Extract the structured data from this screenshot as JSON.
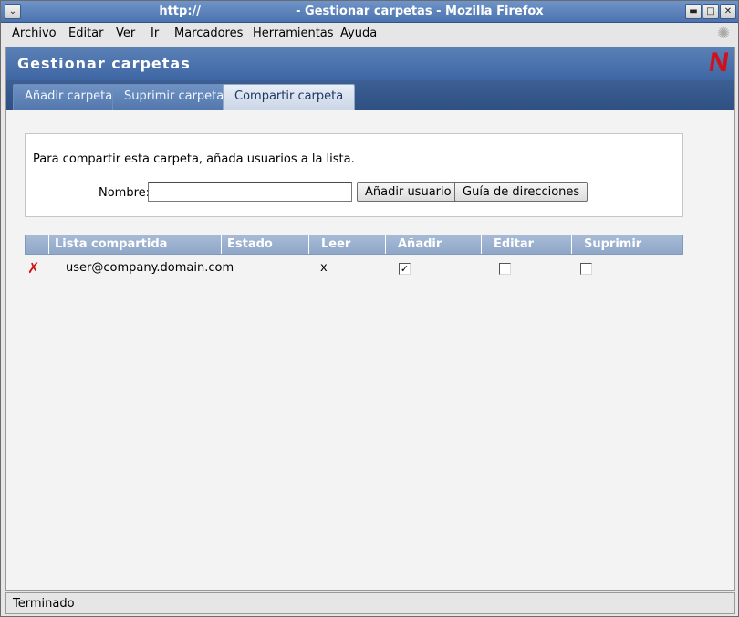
{
  "window": {
    "title": "http://                       - Gestionar carpetas - Mozilla Firefox"
  },
  "menubar": {
    "items": [
      {
        "label": "Archivo"
      },
      {
        "label": "Editar"
      },
      {
        "label": "Ver"
      },
      {
        "label": "Ir"
      },
      {
        "label": "Marcadores"
      },
      {
        "label": "Herramientas"
      },
      {
        "label": "Ayuda"
      }
    ]
  },
  "banner": {
    "heading": "Gestionar carpetas",
    "logo_letter": "N",
    "logo_color": "#d0101a"
  },
  "tabs": [
    {
      "label": "Añadir carpeta",
      "active": false
    },
    {
      "label": "Suprimir carpeta",
      "active": false
    },
    {
      "label": "Compartir carpeta",
      "active": true
    }
  ],
  "share_panel": {
    "hint": "Para compartir esta carpeta, añada usuarios a la lista.",
    "name_label": "Nombre:",
    "name_value": "",
    "add_user_button": "Añadir usuario",
    "address_book_button": "Guía de direcciones"
  },
  "share_table": {
    "columns": [
      "Lista compartida",
      "Estado",
      "Leer",
      "Añadir",
      "Editar",
      "Suprimir"
    ],
    "rows": [
      {
        "user": "user@company.domain.com",
        "status": "",
        "read": "x",
        "add_checked": true,
        "edit_checked": false,
        "delete_checked": false
      }
    ]
  },
  "statusbar": {
    "text": "Terminado"
  }
}
